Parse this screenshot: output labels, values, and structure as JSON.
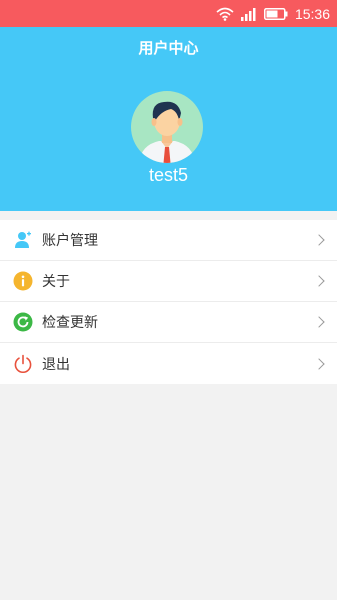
{
  "status_bar": {
    "time": "15:36",
    "icons": [
      "wifi-icon",
      "signal-icon",
      "battery-icon"
    ],
    "background": "#f75a5e"
  },
  "header": {
    "title": "用户中心",
    "username": "test5",
    "background": "#45c8f7"
  },
  "menu": {
    "items": [
      {
        "label": "账户管理",
        "icon": "account-icon",
        "icon_color": "#45c8f7"
      },
      {
        "label": "关于",
        "icon": "info-icon",
        "icon_color": "#f5b52e"
      },
      {
        "label": "检查更新",
        "icon": "refresh-icon",
        "icon_color": "#3cb846"
      },
      {
        "label": "退出",
        "icon": "power-icon",
        "icon_color": "#e8513c"
      }
    ]
  }
}
